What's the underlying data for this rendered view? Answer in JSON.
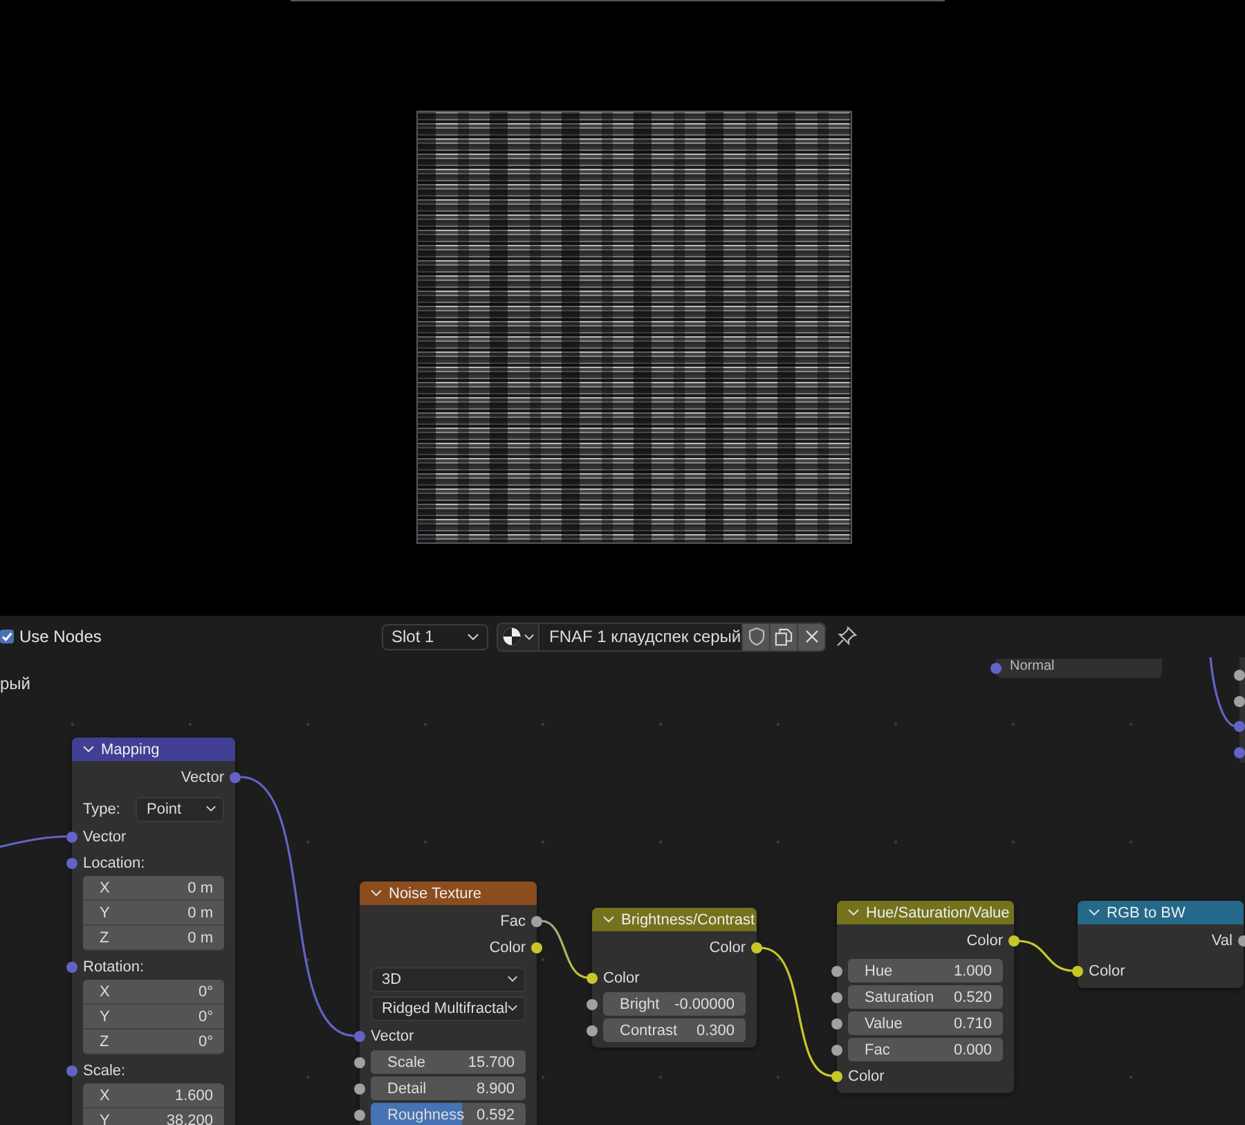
{
  "header": {
    "use_nodes": {
      "label": "Use Nodes",
      "checked": true
    },
    "slot": "Slot 1",
    "material": "FNAF 1 клаудспек серый"
  },
  "canvas_label": "рый",
  "partial_node": {
    "socket_label": "Normal"
  },
  "nodes": [
    {
      "title": "Mapping",
      "color": "#413f94",
      "rows": [
        {
          "kind": "output",
          "label": "Vector",
          "socket": {
            "color": "#6363c7"
          }
        },
        {
          "kind": "labeled_dropdown",
          "label": "Type:",
          "value": "Point"
        },
        {
          "kind": "input",
          "label": "Vector",
          "socket": {
            "color": "#6363c7"
          }
        },
        {
          "kind": "input",
          "label": "Location:",
          "socket": {
            "color": "#6363c7"
          }
        },
        {
          "kind": "vector",
          "items": [
            {
              "axis": "X",
              "value": "0 m"
            },
            {
              "axis": "Y",
              "value": "0 m"
            },
            {
              "axis": "Z",
              "value": "0 m"
            }
          ]
        },
        {
          "kind": "input",
          "label": "Rotation:",
          "socket": {
            "color": "#6363c7"
          }
        },
        {
          "kind": "vector",
          "items": [
            {
              "axis": "X",
              "value": "0°"
            },
            {
              "axis": "Y",
              "value": "0°"
            },
            {
              "axis": "Z",
              "value": "0°"
            }
          ]
        },
        {
          "kind": "input",
          "label": "Scale:",
          "socket": {
            "color": "#6363c7"
          }
        },
        {
          "kind": "vector",
          "items": [
            {
              "axis": "X",
              "value": "1.600"
            },
            {
              "axis": "Y",
              "value": "38.200"
            }
          ]
        }
      ]
    },
    {
      "title": "Noise Texture",
      "color": "#8b4d1e",
      "rows": [
        {
          "kind": "output",
          "label": "Fac",
          "socket": {
            "color": "#a1a1a1"
          }
        },
        {
          "kind": "output",
          "label": "Color",
          "socket": {
            "color": "#c7c729"
          }
        },
        {
          "kind": "dropdown",
          "value": "3D"
        },
        {
          "kind": "dropdown",
          "value": "Ridged Multifractal"
        },
        {
          "kind": "input",
          "label": "Vector",
          "socket": {
            "color": "#6363c7"
          }
        },
        {
          "kind": "field",
          "label": "Scale",
          "value": "15.700",
          "socket": {
            "color": "#a1a1a1"
          }
        },
        {
          "kind": "field",
          "label": "Detail",
          "value": "8.900",
          "socket": {
            "color": "#a1a1a1"
          }
        },
        {
          "kind": "slider",
          "label": "Roughness",
          "value": "0.592",
          "socket": {
            "color": "#a1a1a1"
          },
          "level": 0.592
        }
      ]
    },
    {
      "title": "Brightness/Contrast",
      "color": "#74721c",
      "rows": [
        {
          "kind": "output",
          "label": "Color",
          "socket": {
            "color": "#c7c729"
          }
        },
        {
          "kind": "input",
          "label": "Color",
          "socket": {
            "color": "#c7c729"
          }
        },
        {
          "kind": "field",
          "label": "Bright",
          "value": "-0.00000",
          "socket": {
            "color": "#a1a1a1"
          }
        },
        {
          "kind": "field",
          "label": "Contrast",
          "value": "0.300",
          "socket": {
            "color": "#a1a1a1"
          }
        }
      ]
    },
    {
      "title": "Hue/Saturation/Value",
      "color": "#74721c",
      "rows": [
        {
          "kind": "output",
          "label": "Color",
          "socket": {
            "color": "#c7c729"
          }
        },
        {
          "kind": "field",
          "label": "Hue",
          "value": "1.000",
          "socket": {
            "color": "#a1a1a1"
          }
        },
        {
          "kind": "field",
          "label": "Saturation",
          "value": "0.520",
          "socket": {
            "color": "#a1a1a1"
          }
        },
        {
          "kind": "field",
          "label": "Value",
          "value": "0.710",
          "socket": {
            "color": "#a1a1a1"
          }
        },
        {
          "kind": "field",
          "label": "Fac",
          "value": "0.000",
          "socket": {
            "color": "#a1a1a1"
          }
        },
        {
          "kind": "input",
          "label": "Color",
          "socket": {
            "color": "#c7c729"
          }
        }
      ]
    },
    {
      "title": "RGB to BW",
      "color": "#24698a",
      "rows": [
        {
          "kind": "output",
          "label": "Val",
          "socket": {
            "color": "#a1a1a1"
          }
        },
        {
          "kind": "input",
          "label": "Color",
          "socket": {
            "color": "#c7c729"
          }
        }
      ]
    }
  ]
}
